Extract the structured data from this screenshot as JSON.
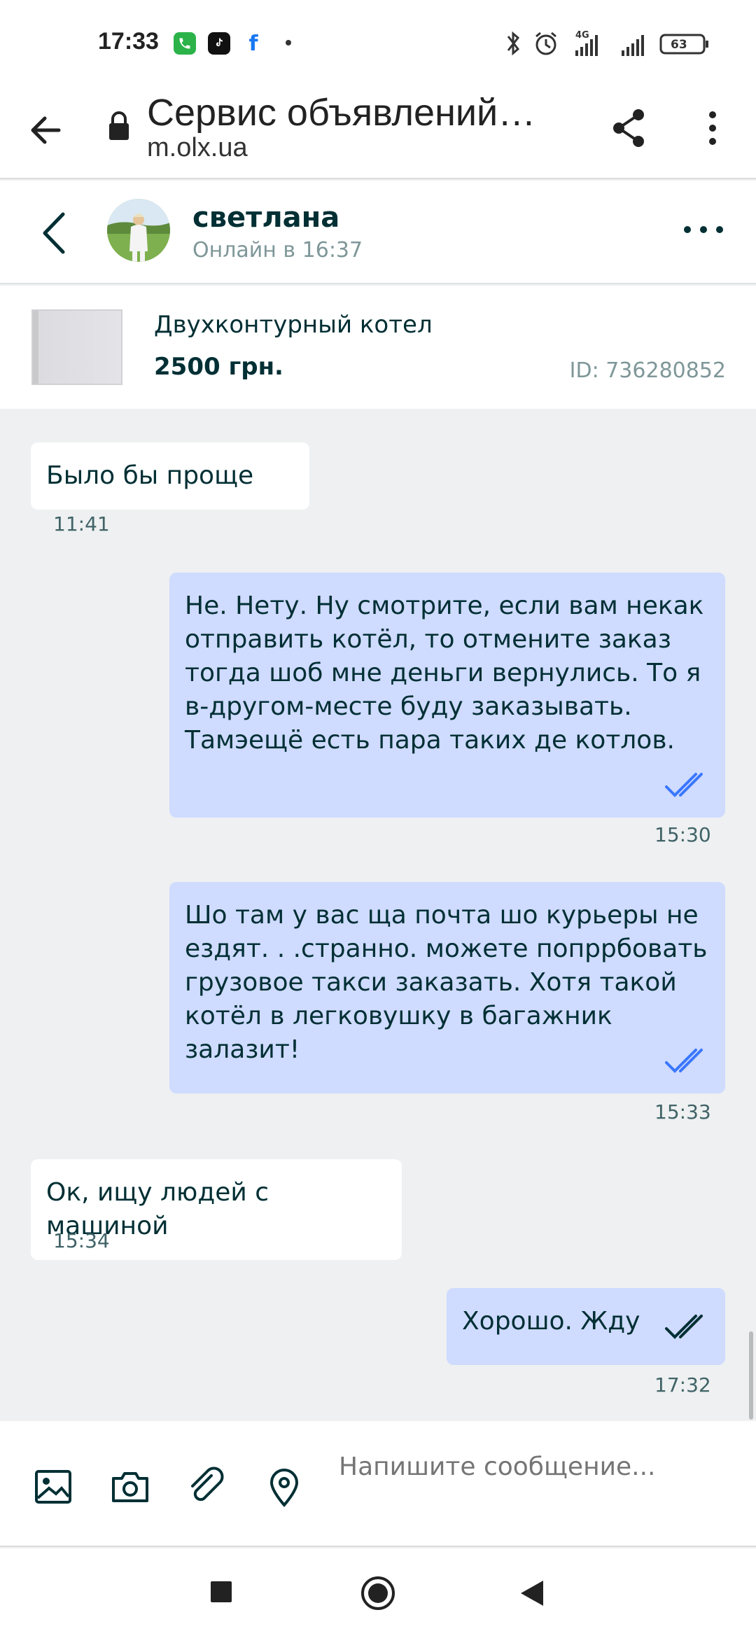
{
  "status_bar": {
    "time": "17:33",
    "network": "4G",
    "battery": "63",
    "icons": [
      "phone-icon",
      "tiktok-icon",
      "facebook-icon",
      "bluetooth-icon",
      "alarm-icon",
      "signal-icon",
      "battery-icon"
    ]
  },
  "browser": {
    "title": "Сервис объявлений…",
    "url": "m.olx.ua"
  },
  "chat": {
    "contact_name": "светлана",
    "contact_status": "Онлайн в 16:37"
  },
  "ad": {
    "title": "Двухконтурный котел",
    "price": "2500 грн.",
    "id": "ID: 736280852"
  },
  "messages": [
    {
      "direction": "in",
      "text": "Было бы проще",
      "time": "11:41"
    },
    {
      "direction": "out",
      "text": "Не. Нету. Ну смотрите, если вам некак отправить котёл, то отмените заказ тогда шоб мне деньги вернулись. То я в-другом-месте буду заказывать. Тамэещё есть пара таких де котлов.",
      "time": "15:30",
      "read": true
    },
    {
      "direction": "out",
      "text": "Шо там у вас ща почта шо курьеры не ездят. . .странно.  можете попррбовать грузовое такси заказать. Хотя такой котёл в легковушку в багажник залазит!",
      "time": "15:33",
      "read": true
    },
    {
      "direction": "in",
      "text": "Ок, ищу людей с машиной",
      "time": "15:34"
    },
    {
      "direction": "out",
      "text": "Хорошо. Жду",
      "time": "17:32",
      "read": true
    }
  ],
  "composer": {
    "placeholder": "Напишите сообщение..."
  },
  "colors": {
    "brand_dark": "#002f34",
    "outgoing_bubble": "#cfdbff",
    "incoming_bubble": "#ffffff",
    "chat_background": "#eef0f1",
    "read_ticks": "#3a77ff"
  }
}
